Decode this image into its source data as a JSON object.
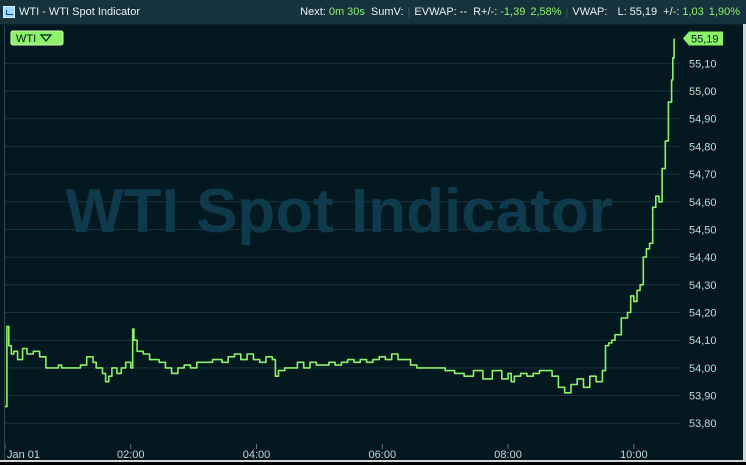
{
  "window": {
    "title": "WTI - WTI Spot Indicator"
  },
  "status": {
    "next_label": "Next:",
    "next_value": "0m 30s",
    "sumv_label": "SumV:",
    "evwap_label": "EVWAP:",
    "evwap_value": "--",
    "rpm_label": "R+/-:",
    "rpm_value": "-1,39",
    "rpm_pct": "2,58%",
    "vwap_label": "VWAP:",
    "l_label": "L:",
    "l_value": "55,19",
    "pm_label": "+/-:",
    "pm_value": "1,03",
    "pm_pct": "1,90%"
  },
  "colors": {
    "line": "#8df26a",
    "grid": "#17343e",
    "watermark": "#0e3a4c",
    "background": "#041820",
    "titlebar": "#16323c"
  },
  "chart_data": {
    "type": "line",
    "watermark": "WTI Spot Indicator",
    "legend_label": "WTI",
    "legend_placement": "top-left",
    "last_value_label": "55,19",
    "grid": true,
    "x_ticks": [
      "Jan 01",
      "02:00",
      "04:00",
      "06:00",
      "08:00",
      "10:00"
    ],
    "xlim_hours": [
      0,
      10.75
    ],
    "y_ticks": [
      "53,80",
      "53,90",
      "54,00",
      "54,10",
      "54,20",
      "54,30",
      "54,40",
      "54,50",
      "54,60",
      "54,70",
      "54,80",
      "54,90",
      "55,00",
      "55,10"
    ],
    "ylim": [
      53.725,
      55.235
    ],
    "series": [
      {
        "x": [
          0,
          0.03,
          0.06,
          0.1,
          0.14,
          0.2,
          0.28,
          0.35,
          0.45,
          0.55,
          0.65,
          0.78,
          0.85,
          0.9,
          1.0,
          1.1,
          1.2,
          1.3,
          1.4,
          1.45,
          1.55,
          1.6,
          1.65,
          1.7,
          1.78,
          1.85,
          1.92,
          2.0,
          2.03,
          2.05,
          2.1,
          2.2,
          2.3,
          2.45,
          2.55,
          2.65,
          2.75,
          2.85,
          2.95,
          3.05,
          3.15,
          3.3,
          3.45,
          3.55,
          3.65,
          3.75,
          3.85,
          3.95,
          4.05,
          4.15,
          4.25,
          4.3,
          4.35,
          4.45,
          4.55,
          4.65,
          4.75,
          4.85,
          4.95,
          5.05,
          5.15,
          5.25,
          5.35,
          5.45,
          5.55,
          5.65,
          5.75,
          5.85,
          5.95,
          6.05,
          6.15,
          6.25,
          6.35,
          6.45,
          6.55,
          6.7,
          6.85,
          7.0,
          7.15,
          7.3,
          7.45,
          7.6,
          7.75,
          7.9,
          8.0,
          8.05,
          8.1,
          8.2,
          8.3,
          8.4,
          8.5,
          8.6,
          8.7,
          8.8,
          8.9,
          9.0,
          9.1,
          9.2,
          9.3,
          9.4,
          9.5,
          9.55,
          9.6,
          9.65,
          9.7,
          9.8,
          9.9,
          9.95,
          10.0,
          10.05,
          10.1,
          10.15,
          10.2,
          10.25,
          10.3,
          10.35,
          10.4,
          10.45,
          10.5,
          10.55,
          10.6,
          10.62,
          10.64
        ],
        "values": [
          53.86,
          54.15,
          54.08,
          54.05,
          54.06,
          54.03,
          54.07,
          54.05,
          54.06,
          54.04,
          54.0,
          54.0,
          54.01,
          54.0,
          54.0,
          54.0,
          54.01,
          54.04,
          54.02,
          54.0,
          53.98,
          53.95,
          53.97,
          54.0,
          53.98,
          54.0,
          54.02,
          54.0,
          54.14,
          54.1,
          54.06,
          54.05,
          54.03,
          54.02,
          54.0,
          53.98,
          54.0,
          54.01,
          54.0,
          54.02,
          54.02,
          54.03,
          54.02,
          54.04,
          54.05,
          54.03,
          54.05,
          54.03,
          54.02,
          54.04,
          54.03,
          53.97,
          53.99,
          54.0,
          54.0,
          54.02,
          54.0,
          54.02,
          54.01,
          54.01,
          54.02,
          54.01,
          54.02,
          54.03,
          54.02,
          54.03,
          54.02,
          54.03,
          54.04,
          54.03,
          54.05,
          54.03,
          54.03,
          54.01,
          54.0,
          54.0,
          54.0,
          53.99,
          53.98,
          53.97,
          53.99,
          53.96,
          53.99,
          53.96,
          53.98,
          53.95,
          53.97,
          53.98,
          53.97,
          53.98,
          53.99,
          53.99,
          53.97,
          53.93,
          53.91,
          53.94,
          53.96,
          53.93,
          53.97,
          53.95,
          53.99,
          54.08,
          54.09,
          54.1,
          54.12,
          54.18,
          54.2,
          54.26,
          54.24,
          54.28,
          54.3,
          54.4,
          54.43,
          54.45,
          54.58,
          54.62,
          54.6,
          54.72,
          54.82,
          54.96,
          55.04,
          55.12,
          55.19
        ]
      }
    ]
  }
}
